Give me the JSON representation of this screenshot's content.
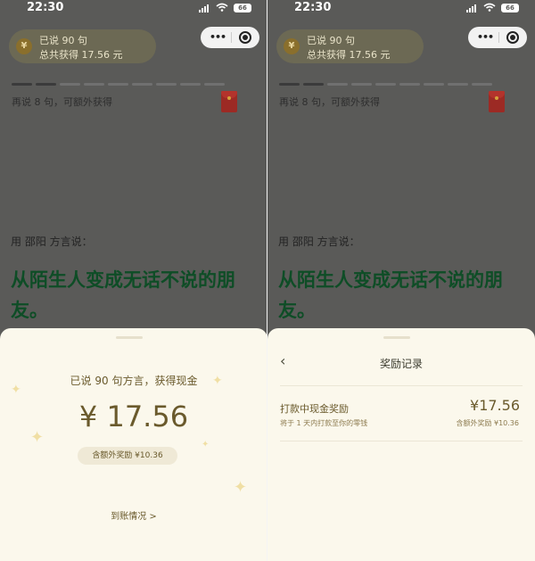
{
  "status_bar": {
    "time": "22:30",
    "battery": "66"
  },
  "header": {
    "spoken_label": "已说 90 句",
    "earned_label": "总共获得 17.56 元",
    "coin_symbol": "¥"
  },
  "progress": {
    "segments_total": 10,
    "segments_done": 2,
    "hint": "再说 8 句，可额外获得"
  },
  "dialect_prompt": "用 邵阳 方言说：",
  "phrase": "从陌生人变成无话不说的朋友。",
  "reward_sheet": {
    "headline": "已说 90 句方言，获得现金",
    "amount": "¥ 17.56",
    "bonus_badge": "含额外奖励 ¥10.36",
    "details_link": "到账情况 >"
  },
  "records_sheet": {
    "back_icon": "‹",
    "title": "奖励记录",
    "item": {
      "name": "打款中现金奖励",
      "note": "将于 1 天内打款至你的零钱",
      "amount": "¥17.56",
      "bonus": "含额外奖励 ¥10.36"
    }
  },
  "colors": {
    "overlay": "#5a5a58",
    "sheet": "#fbf8ec",
    "gold_text": "#6a5a2c",
    "phrase_green": "#0e4d26"
  }
}
